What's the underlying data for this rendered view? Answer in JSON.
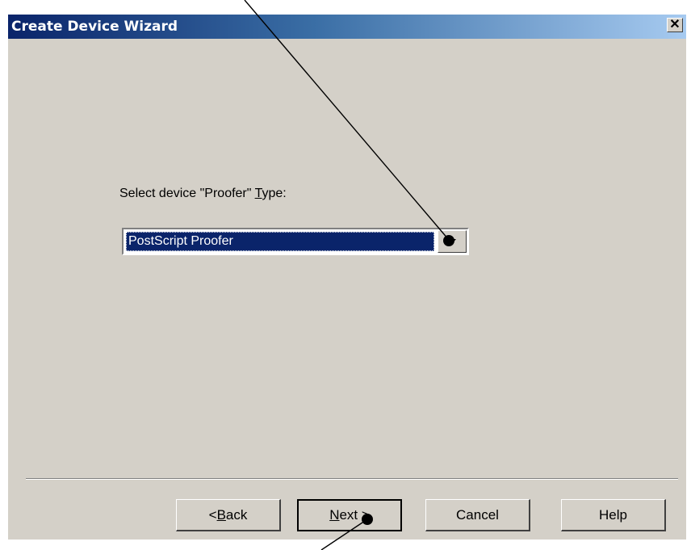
{
  "window": {
    "title": "Create Device Wizard",
    "close_symbol": "✕"
  },
  "prompt": {
    "before": "Select device \"Proofer\" ",
    "accelerator": "T",
    "after": "ype:"
  },
  "combo": {
    "value": "PostScript Proofer",
    "arrow_icon": "chevron-down-icon"
  },
  "buttons": {
    "back": {
      "prefix": "< ",
      "accelerator": "B",
      "rest": "ack"
    },
    "next": {
      "accelerator": "N",
      "rest": "ext >"
    },
    "cancel": "Cancel",
    "help": "Help"
  },
  "colors": {
    "dialog_bg": "#d4d0c8",
    "title_gradient_start": "#0a246a",
    "title_gradient_end": "#a6caf0",
    "selection_bg": "#0a246a"
  }
}
